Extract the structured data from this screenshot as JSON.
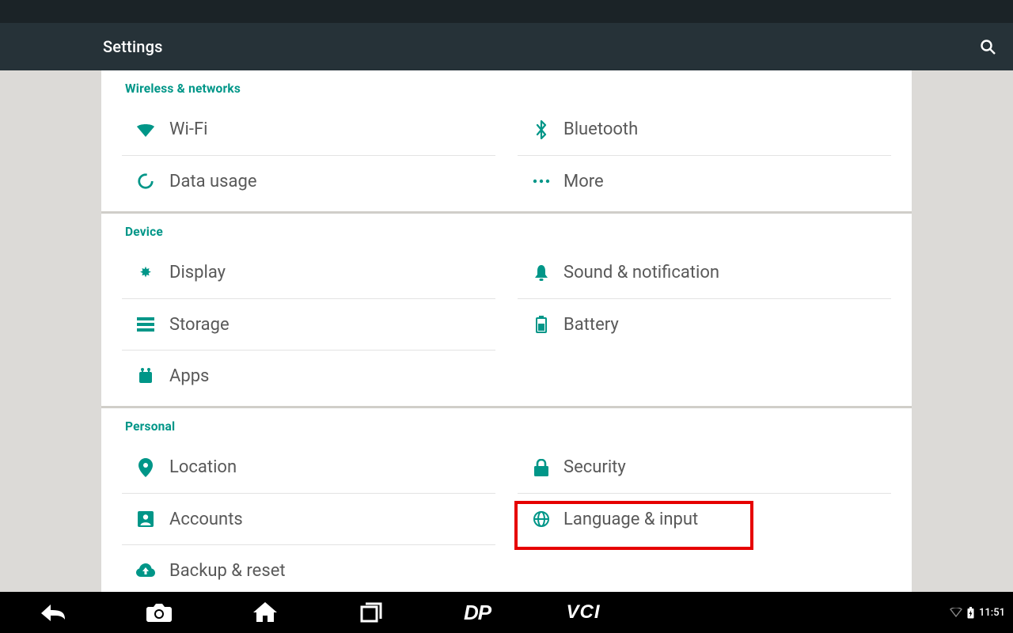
{
  "appbar": {
    "title": "Settings"
  },
  "sections": [
    {
      "header": "Wireless & networks",
      "left": [
        {
          "label": "Wi-Fi",
          "icon": "wifi"
        },
        {
          "label": "Data usage",
          "icon": "data-usage"
        }
      ],
      "right": [
        {
          "label": "Bluetooth",
          "icon": "bluetooth"
        },
        {
          "label": "More",
          "icon": "more"
        }
      ]
    },
    {
      "header": "Device",
      "left": [
        {
          "label": "Display",
          "icon": "display"
        },
        {
          "label": "Storage",
          "icon": "storage"
        },
        {
          "label": "Apps",
          "icon": "apps"
        }
      ],
      "right": [
        {
          "label": "Sound & notification",
          "icon": "bell"
        },
        {
          "label": "Battery",
          "icon": "battery"
        }
      ]
    },
    {
      "header": "Personal",
      "left": [
        {
          "label": "Location",
          "icon": "location"
        },
        {
          "label": "Accounts",
          "icon": "account"
        },
        {
          "label": "Backup & reset",
          "icon": "backup"
        }
      ],
      "right": [
        {
          "label": "Security",
          "icon": "security"
        },
        {
          "label": "Language & input",
          "icon": "language",
          "highlighted": true
        }
      ]
    }
  ],
  "navbar": {
    "buttons": [
      "back",
      "camera",
      "home",
      "recent",
      "dp",
      "vci"
    ],
    "clock": "11:51"
  },
  "colors": {
    "accent": "#009688"
  }
}
